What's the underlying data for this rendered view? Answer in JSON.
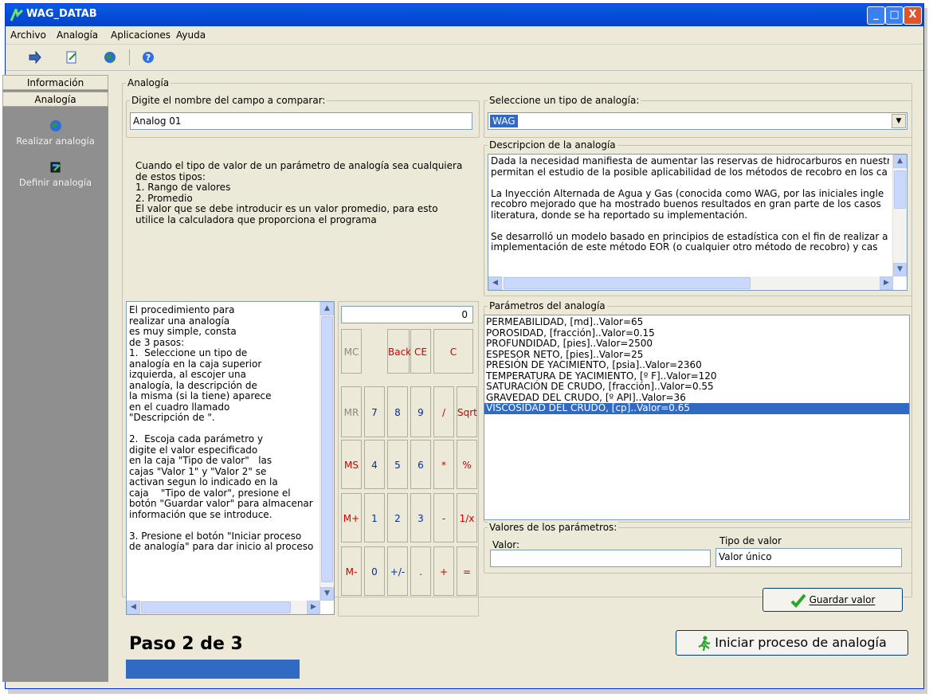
{
  "window": {
    "title": "WAG_DATAB",
    "controls": [
      "_",
      "□",
      "X"
    ]
  },
  "menu": [
    "Archivo",
    "Analogía",
    "Aplicaciones",
    "Ayuda"
  ],
  "toolbar": {
    "icons": [
      "arrow-right-icon",
      "edit-icon",
      "globe-icon",
      "help-icon"
    ]
  },
  "sidebar": {
    "tabs": [
      "Información",
      "Analogía"
    ],
    "items": [
      "Realizar analogía",
      "Definir analogía"
    ]
  },
  "analogia": {
    "group_label": "Analogía",
    "campo_label": "Digite el nombre del campo a comparar:",
    "campo_value": "Analog 01",
    "tipo_label": "Seleccione un tipo de analogía:",
    "tipo_value": "WAG",
    "info_text": "Cuando el tipo de valor de un parámetro de analogía sea cualquiera\nde estos tipos:\n1. Rango de valores\n2. Promedio\nEl valor que se debe introducir es un valor promedio, para esto\nutilice la calculadora que proporciona el programa",
    "desc_label": "Descripcion de la analogía",
    "desc_text": "Dada la necesidad manifiesta de aumentar las reservas de hidrocarburos en nuestr\npermitan el estudio de la posible aplicabilidad de los métodos de recobro en los ca\n\nLa Inyección Alternada de Agua y Gas (conocida como WAG, por las iniciales ingle\nrecobro mejorado que ha mostrado buenos resultados en gran parte de los casos\nliteratura, donde se ha reportado su implementación.\n\nSe desarrolló un modelo basado en principios de estadística con el fin de realizar a\nimplementación de este método EOR (o cualquier otro método de recobro) y cas"
  },
  "procedure_text": "El procedimiento para\nrealizar una analogía\nes muy simple, consta\nde 3 pasos:\n1.  Seleccione un tipo de\nanalogía en la caja superior\nizquierda, al escojer una\nanalogía, la descripción de\nla misma (si la tiene) aparece\nen el cuadro llamado\n\"Descripción de \".\n\n2.  Escoja cada parámetro y\ndigite el valor especificado\nen la caja \"Tipo de valor\"   las\ncajas \"Valor 1\" y \"Valor 2\" se\nactivan segun lo indicado en la\ncaja    \"Tipo de valor\", presione el\nbotón \"Guardar valor\" para almacenar\ninformación que se introduce.\n\n3. Presione el botón \"Iniciar proceso\nde analogía\" para dar inicio al proceso",
  "calculator": {
    "display": "0",
    "rows": [
      [
        "MC",
        "",
        "Back",
        "CE",
        "C"
      ],
      [
        "MR",
        "7",
        "8",
        "9",
        "/",
        "Sqrt"
      ],
      [
        "MS",
        "4",
        "5",
        "6",
        "*",
        "%"
      ],
      [
        "M+",
        "1",
        "2",
        "3",
        "-",
        "1/x"
      ],
      [
        "M-",
        "0",
        "+/-",
        ".",
        "+",
        "="
      ]
    ]
  },
  "parametros": {
    "label": "Parámetros del analogía",
    "items": [
      "PERMEABILIDAD, [md]..Valor=65",
      "POROSIDAD, [fracción]..Valor=0.15",
      "PROFUNDIDAD, [pies]..Valor=2500",
      "ESPESOR NETO, [pies]..Valor=25",
      "PRESIÓN DE YACIMIENTO, [psia]..Valor=2360",
      "TEMPERATURA DE YACIMIENTO, [º F]..Valor=120",
      "SATURACIÓN DE CRUDO, [fracción]..Valor=0.55",
      "GRAVEDAD DEL CRUDO, [º API]..Valor=36",
      "VISCOSIDAD DEL CRUDO, [cp]..Valor=0.65"
    ],
    "selected_index": 8
  },
  "valores": {
    "label": "Valores de los parámetros:",
    "valor_label": "Valor:",
    "valor_value": "",
    "tipo_label": "Tipo de valor",
    "tipo_value": "Valor único"
  },
  "buttons": {
    "guardar": "Guardar valor",
    "iniciar": "Iniciar proceso de analogía"
  },
  "status": {
    "paso": "Paso 2 de 3",
    "progress": 0.33
  },
  "colors": {
    "titlebar": "#0550dd",
    "selection": "#316ac5",
    "progress": "#316ac5",
    "sidebar": "#8f8f8f"
  }
}
